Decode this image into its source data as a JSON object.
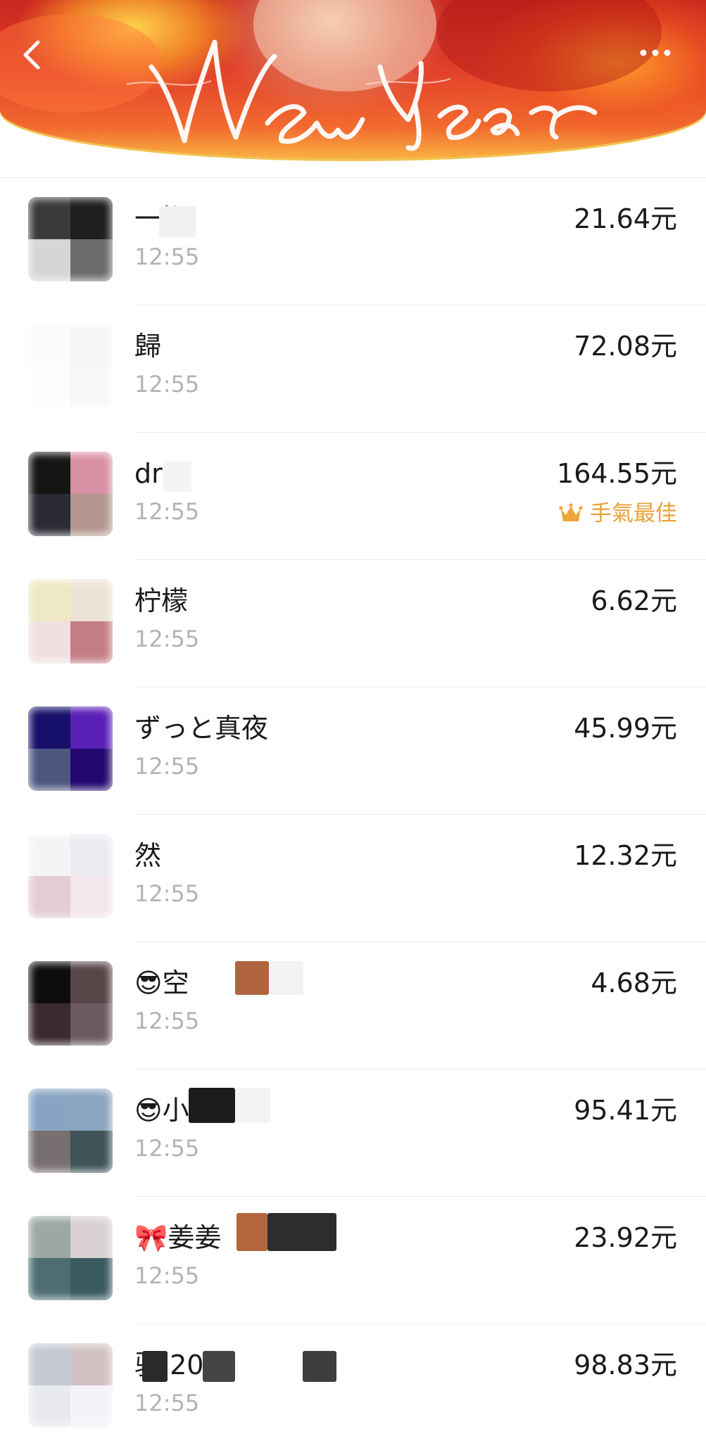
{
  "header": {
    "banner_text": "New Year",
    "back_icon": "chevron-left-icon",
    "more_icon": "more-dots-icon"
  },
  "colors": {
    "best_luck": "#e9a23b",
    "time_text": "#b3b3b3",
    "divider": "#ededed"
  },
  "entries": [
    {
      "name": "一桁",
      "time": "12:55",
      "amount": "21.64元"
    },
    {
      "name": "歸",
      "time": "12:55",
      "amount": "72.08元"
    },
    {
      "name": "dr",
      "time": "12:55",
      "amount": "164.55元",
      "badge": "手氣最佳",
      "badge_icon": "crown-icon"
    },
    {
      "name": "柠檬",
      "time": "12:55",
      "amount": "6.62元"
    },
    {
      "name": "ずっと真夜",
      "time": "12:55",
      "amount": "45.99元"
    },
    {
      "name": "然",
      "time": "12:55",
      "amount": "12.32元"
    },
    {
      "name": "😎空",
      "time": "12:55",
      "amount": "4.68元"
    },
    {
      "name": "😎小",
      "time": "12:55",
      "amount": "95.41元"
    },
    {
      "name": "🎀姜姜",
      "time": "12:55",
      "amount": "23.92元"
    },
    {
      "name": "驮            20",
      "time": "12:55",
      "amount": "98.83元"
    }
  ]
}
